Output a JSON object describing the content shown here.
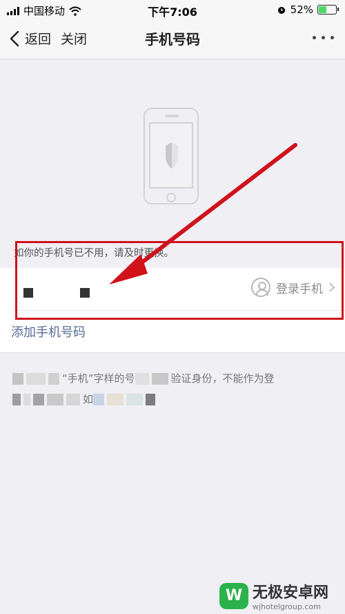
{
  "status_bar": {
    "carrier": "中国移动",
    "time": "下午7:06",
    "battery": "52%",
    "battery_level": 0.52
  },
  "nav": {
    "back_label": "返回",
    "close_label": "关闭",
    "title": "手机号码"
  },
  "hint": "如你的手机号已不用，请及时更换。",
  "phone_row": {
    "login_label": "登录手机"
  },
  "add_phone_label": "添加手机号码",
  "notice": {
    "line1": "“手机”字样的号",
    "line1_b": "验证身份，不能作为登",
    "line2": "如"
  },
  "watermark": {
    "name": "无极安卓网",
    "url": "wjhotelgroup.com"
  },
  "colors": {
    "accent_link": "#576b95",
    "annotation_red": "#d0121b",
    "battery_green": "#4cd964"
  }
}
